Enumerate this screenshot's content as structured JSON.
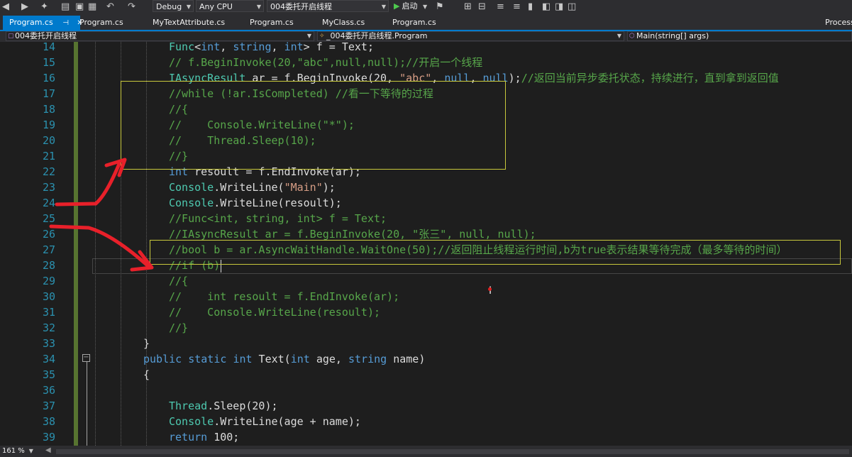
{
  "toolbar": {
    "config": "Debug",
    "platform": "Any CPU",
    "project": "004委托开启线程",
    "start_label": "启动"
  },
  "tabs": [
    {
      "label": "Program.cs",
      "active": true
    },
    {
      "label": "Program.cs"
    },
    {
      "label": "MyTextAttribute.cs"
    },
    {
      "label": "Program.cs"
    },
    {
      "label": "MyClass.cs"
    },
    {
      "label": "Program.cs"
    },
    {
      "label": "Process"
    }
  ],
  "navbar": {
    "project": "004委托开启线程",
    "class": "_004委托开启线程.Program",
    "member": "Main(string[] args)"
  },
  "editor": {
    "line_numbers": [
      "14",
      "15",
      "16",
      "17",
      "18",
      "19",
      "20",
      "21",
      "22",
      "23",
      "24",
      "25",
      "26",
      "27",
      "28",
      "29",
      "30",
      "31",
      "32",
      "33",
      "34",
      "35",
      "36",
      "37",
      "38",
      "39"
    ],
    "code_lines": [
      [
        {
          "t": "Func",
          "c": "ty"
        },
        {
          "t": "<",
          "c": "pl"
        },
        {
          "t": "int",
          "c": "kw"
        },
        {
          "t": ", ",
          "c": "pl"
        },
        {
          "t": "string",
          "c": "kw"
        },
        {
          "t": ", ",
          "c": "pl"
        },
        {
          "t": "int",
          "c": "kw"
        },
        {
          "t": "> f = Text;",
          "c": "pl"
        }
      ],
      [
        {
          "t": "// f.BeginInvoke(20,\"abc\",null,null);//开启一个线程",
          "c": "cmt"
        }
      ],
      [
        {
          "t": "IAsyncResult",
          "c": "ty"
        },
        {
          "t": " ar = f.BeginInvoke(20, ",
          "c": "pl"
        },
        {
          "t": "\"abc\"",
          "c": "str"
        },
        {
          "t": ", ",
          "c": "pl"
        },
        {
          "t": "null",
          "c": "kw"
        },
        {
          "t": ", ",
          "c": "pl"
        },
        {
          "t": "null",
          "c": "kw"
        },
        {
          "t": ");",
          "c": "pl"
        },
        {
          "t": "//返回当前异步委托状态，持续进行，直到拿到返回值",
          "c": "cmt"
        }
      ],
      [
        {
          "t": "//while (!ar.IsCompleted) //看一下等待的过程",
          "c": "cmt"
        }
      ],
      [
        {
          "t": "//{",
          "c": "cmt"
        }
      ],
      [
        {
          "t": "//    Console.WriteLine(\"*\");",
          "c": "cmt"
        }
      ],
      [
        {
          "t": "//    Thread.Sleep(10);",
          "c": "cmt"
        }
      ],
      [
        {
          "t": "//}",
          "c": "cmt"
        }
      ],
      [
        {
          "t": "int",
          "c": "kw"
        },
        {
          "t": " resoult = f.EndInvoke(ar);",
          "c": "pl"
        }
      ],
      [
        {
          "t": "Console",
          "c": "ty"
        },
        {
          "t": ".WriteLine(",
          "c": "pl"
        },
        {
          "t": "\"Main\"",
          "c": "str"
        },
        {
          "t": ");",
          "c": "pl"
        }
      ],
      [
        {
          "t": "Console",
          "c": "ty"
        },
        {
          "t": ".WriteLine(resoult);",
          "c": "pl"
        }
      ],
      [
        {
          "t": "//Func<int, string, int> f = Text;",
          "c": "cmt"
        }
      ],
      [
        {
          "t": "//IAsyncResult ar = f.BeginInvoke(20, \"张三\", null, null);",
          "c": "cmt"
        }
      ],
      [
        {
          "t": "//bool b = ar.AsyncWaitHandle.WaitOne(50);//返回阻止线程运行时间,b为true表示结果等待完成（最多等待的时间）",
          "c": "cmt"
        }
      ],
      [
        {
          "t": "//if (b)",
          "c": "cmt"
        }
      ],
      [
        {
          "t": "//{",
          "c": "cmt"
        }
      ],
      [
        {
          "t": "//    int resoult = f.EndInvoke(ar);",
          "c": "cmt"
        }
      ],
      [
        {
          "t": "//    Console.WriteLine(resoult);",
          "c": "cmt"
        }
      ],
      [
        {
          "t": "//}",
          "c": "cmt"
        }
      ],
      [
        {
          "t": "}",
          "c": "pl"
        }
      ],
      [
        {
          "t": "public",
          "c": "kw"
        },
        {
          "t": " ",
          "c": "pl"
        },
        {
          "t": "static",
          "c": "kw"
        },
        {
          "t": " ",
          "c": "pl"
        },
        {
          "t": "int",
          "c": "kw"
        },
        {
          "t": " Text(",
          "c": "pl"
        },
        {
          "t": "int",
          "c": "kw"
        },
        {
          "t": " age, ",
          "c": "pl"
        },
        {
          "t": "string",
          "c": "kw"
        },
        {
          "t": " name)",
          "c": "pl"
        }
      ],
      [
        {
          "t": "{",
          "c": "pl"
        }
      ],
      [],
      [
        {
          "t": "Thread",
          "c": "ty"
        },
        {
          "t": ".Sleep(20);",
          "c": "pl"
        }
      ],
      [
        {
          "t": "Console",
          "c": "ty"
        },
        {
          "t": ".WriteLine(age + name);",
          "c": "pl"
        }
      ],
      [
        {
          "t": "return",
          "c": "kw"
        },
        {
          "t": " 100;",
          "c": "pl"
        }
      ]
    ],
    "indent": [
      4,
      4,
      4,
      4,
      4,
      4,
      4,
      4,
      4,
      4,
      4,
      4,
      4,
      4,
      4,
      4,
      4,
      4,
      4,
      3,
      3,
      3,
      4,
      4,
      4,
      4
    ]
  },
  "statusbar": {
    "zoom": "161 %"
  },
  "colors": {
    "accent": "#007acc",
    "comment": "#57a64a",
    "keyword": "#569cd6",
    "type": "#4ec9b0",
    "string": "#d69d85",
    "annotation": "#e8202a",
    "highlight_box": "#c8c83c"
  }
}
